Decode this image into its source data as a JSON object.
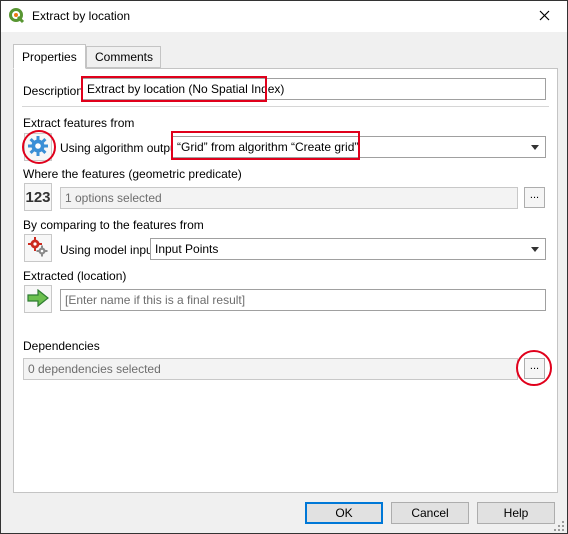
{
  "window": {
    "title": "Extract by location"
  },
  "tabs": [
    {
      "label": "Properties",
      "active": true
    },
    {
      "label": "Comments",
      "active": false
    }
  ],
  "description": {
    "label": "Description",
    "value": "Extract by location (No Spatial Index)"
  },
  "extract_from": {
    "label": "Extract features from",
    "source_label": "Using algorithm output",
    "value": "“Grid” from algorithm “Create grid”"
  },
  "predicate": {
    "label": "Where the features (geometric predicate)",
    "icon_text": "123",
    "value": "1 options selected",
    "browse_label": "..."
  },
  "compare": {
    "label": "By comparing to the features from",
    "source_label": "Using model input",
    "value": "Input Points"
  },
  "extracted": {
    "label": "Extracted (location)",
    "placeholder": "[Enter name if this is a final result]"
  },
  "dependencies": {
    "label": "Dependencies",
    "value": "0 dependencies selected",
    "browse_label": "..."
  },
  "footer": {
    "ok_label": "OK",
    "cancel_label": "Cancel",
    "help_label": "Help"
  },
  "colors": {
    "highlight": "#e0001b",
    "accent": "#0078d7",
    "qgis_green": "#589632"
  },
  "icons": [
    "qgis-logo-icon",
    "close-icon",
    "algorithm-gear-icon",
    "number-source-icon",
    "model-input-gears-icon",
    "output-arrow-icon",
    "resize-grip-icon"
  ]
}
